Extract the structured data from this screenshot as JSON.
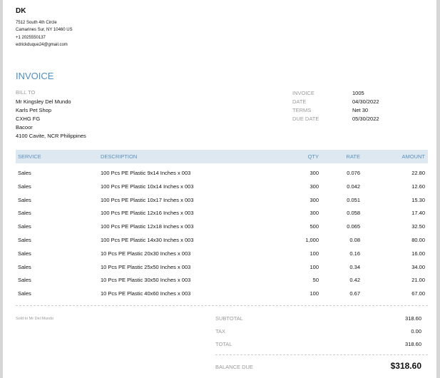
{
  "company": {
    "name": "DK",
    "address_lines": [
      "7512 South 4th Circle",
      "Camarines Sur, NY  10460 US",
      "+1 2025550137",
      "edrickduque24@gmail.com"
    ]
  },
  "invoice_title": "INVOICE",
  "bill_to": {
    "label": "BILL TO",
    "lines": [
      "Mr Kingsley Del Mundo",
      "Karls Pet Shop",
      "CXHG FG",
      "Bacoor",
      "4100 Cavite, NCR Philippines"
    ]
  },
  "meta": [
    {
      "label": "INVOICE",
      "value": "1005"
    },
    {
      "label": "DATE",
      "value": "04/30/2022"
    },
    {
      "label": "TERMS",
      "value": "Net 30"
    },
    {
      "label": "DUE DATE",
      "value": "05/30/2022"
    }
  ],
  "table": {
    "headers": {
      "service": "SERVICE",
      "description": "DESCRIPTION",
      "qty": "QTY",
      "rate": "RATE",
      "amount": "AMOUNT"
    },
    "rows": [
      {
        "service": "Sales",
        "description": "100 Pcs PE Plastic 9x14 Inches x 003",
        "qty": "300",
        "rate": "0.076",
        "amount": "22.80"
      },
      {
        "service": "Sales",
        "description": "100 Pcs PE Plastic 10x14 Inches x 003",
        "qty": "300",
        "rate": "0.042",
        "amount": "12.60"
      },
      {
        "service": "Sales",
        "description": "100 Pcs PE Plastic 10x17 Inches x 003",
        "qty": "300",
        "rate": "0.051",
        "amount": "15.30"
      },
      {
        "service": "Sales",
        "description": "100 Pcs PE Plastic 12x16 Inches x 003",
        "qty": "300",
        "rate": "0.058",
        "amount": "17.40"
      },
      {
        "service": "Sales",
        "description": "100 Pcs PE Plastic 12x18 Inches x 003",
        "qty": "500",
        "rate": "0.065",
        "amount": "32.50"
      },
      {
        "service": "Sales",
        "description": "100 Pcs PE Plastic 14x30 Inches x 003",
        "qty": "1,000",
        "rate": "0.08",
        "amount": "80.00"
      },
      {
        "service": "Sales",
        "description": "10 Pcs PE Plastic 20x30 Inches x 003",
        "qty": "100",
        "rate": "0.16",
        "amount": "16.00"
      },
      {
        "service": "Sales",
        "description": "10 Pcs PE Plastic 25x50 Inches x 003",
        "qty": "100",
        "rate": "0.34",
        "amount": "34.00"
      },
      {
        "service": "Sales",
        "description": "10 Pcs PE Plastic 30x50 Inches x 003",
        "qty": "50",
        "rate": "0.42",
        "amount": "21.00"
      },
      {
        "service": "Sales",
        "description": "10 Pcs PE Plastic 40x60 Inches x 003",
        "qty": "100",
        "rate": "0.67",
        "amount": "67.00"
      }
    ]
  },
  "note": "Sold to Mr Del Mundo",
  "totals": {
    "subtotal_label": "SUBTOTAL",
    "subtotal": "318.60",
    "tax_label": "TAX",
    "tax": "0.00",
    "total_label": "TOTAL",
    "total": "318.60",
    "balance_label": "BALANCE DUE",
    "balance": "$318.60"
  }
}
